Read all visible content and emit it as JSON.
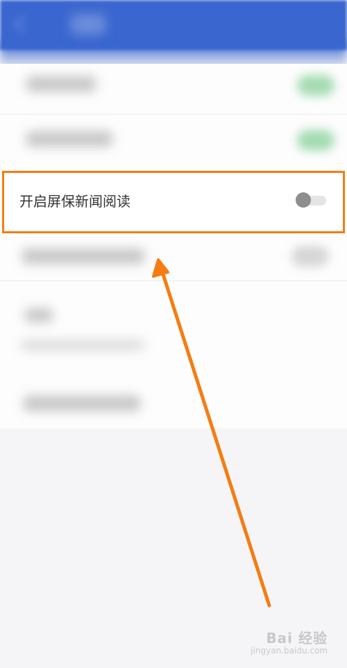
{
  "setting": {
    "label": "开启屏保新闻阅读",
    "enabled": false
  },
  "watermark": {
    "brand": "Bai 经验",
    "url": "jingyan.baidu.com"
  },
  "colors": {
    "header": "#3a66cf",
    "annotation": "#f57c12",
    "toggle_knob_off": "#8e8e8e"
  }
}
